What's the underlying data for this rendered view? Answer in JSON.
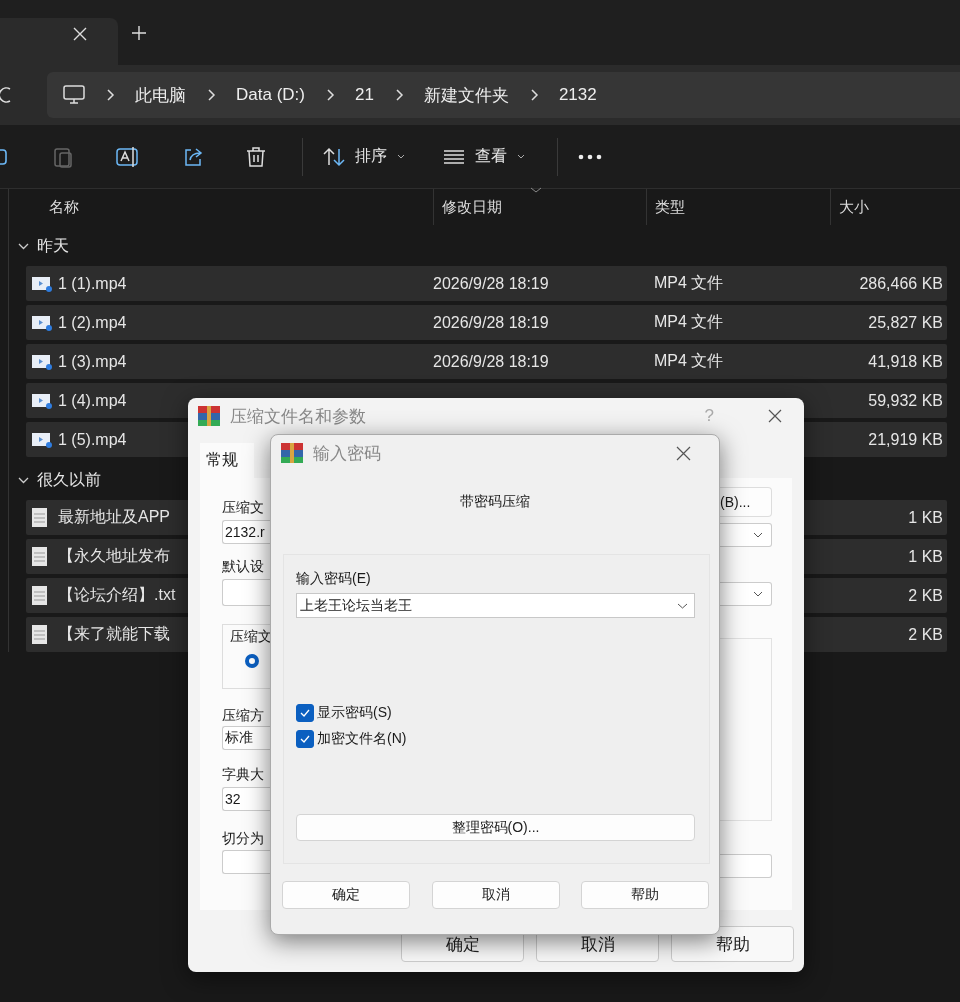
{
  "breadcrumb": [
    "此电脑",
    "Data (D:)",
    "21",
    "新建文件夹",
    "2132"
  ],
  "toolbar": {
    "sort": "排序",
    "view": "查看"
  },
  "columns": [
    "名称",
    "修改日期",
    "类型",
    "大小"
  ],
  "groups": [
    {
      "label": "昨天",
      "expanded": true,
      "files": [
        {
          "kind": "video",
          "name": "1 (1).mp4",
          "date": "2026/9/28 18:19",
          "type": "MP4 文件",
          "size": "286,466 KB",
          "selected": true
        },
        {
          "kind": "video",
          "name": "1 (2).mp4",
          "date": "2026/9/28 18:19",
          "type": "MP4 文件",
          "size": "25,827 KB",
          "selected": true
        },
        {
          "kind": "video",
          "name": "1 (3).mp4",
          "date": "2026/9/28 18:19",
          "type": "MP4 文件",
          "size": "41,918 KB",
          "selected": true
        },
        {
          "kind": "video",
          "name": "1 (4).mp4",
          "size": "59,932 KB",
          "selected": true
        },
        {
          "kind": "video",
          "name": "1 (5).mp4",
          "size": "21,919 KB",
          "selected": true
        }
      ]
    },
    {
      "label": "很久以前",
      "expanded": true,
      "files": [
        {
          "kind": "text",
          "name": "最新地址及APP",
          "size": "1 KB",
          "selected": true
        },
        {
          "kind": "text",
          "name": "【永久地址发布",
          "size": "1 KB",
          "selected": true
        },
        {
          "kind": "text",
          "name": "【论坛介绍】.txt",
          "size": "2 KB",
          "selected": true
        },
        {
          "kind": "text",
          "name": "【来了就能下载",
          "size": "2 KB",
          "selected": true
        }
      ]
    }
  ],
  "archive_dialog": {
    "title": "压缩文件名和参数",
    "help_mark": "?",
    "tabs": [
      {
        "label": "常规",
        "selected": true
      }
    ],
    "archive_name_label": "压缩文",
    "archive_name_value": "2132.r",
    "browse_button": "(B)...",
    "profile_label": "默认设",
    "format_group_label": "压缩文",
    "format_radio_selected": true,
    "method_label": "压缩方",
    "method_value": "标准",
    "dictionary_label": "字典大",
    "dictionary_value": "32",
    "split_label": "切分为",
    "buttons": [
      "确定",
      "取消",
      "帮助"
    ]
  },
  "password_dialog": {
    "title": "输入密码",
    "heading": "带密码压缩",
    "password_label": "输入密码(E)",
    "password_value": "上老王论坛当老王",
    "checkboxes": [
      {
        "label": "显示密码(S)",
        "checked": true
      },
      {
        "label": "加密文件名(N)",
        "checked": true
      }
    ],
    "organize_button": "整理密码(O)...",
    "buttons": [
      "确定",
      "取消",
      "帮助"
    ]
  }
}
